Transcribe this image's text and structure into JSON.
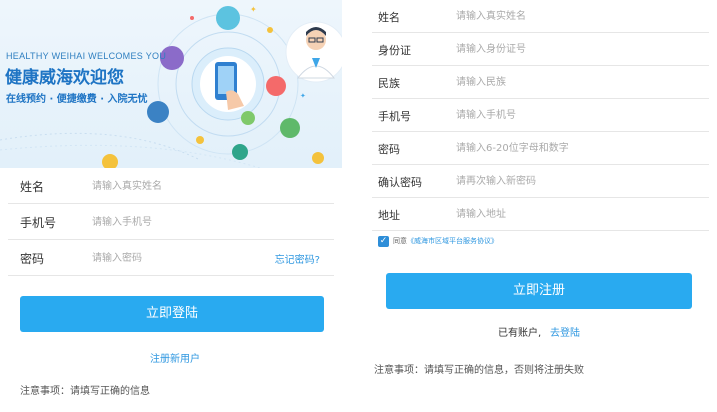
{
  "login": {
    "banner": {
      "subtitle": "HEALTHY WEIHAI WELCOMES YOU",
      "title": "健康威海欢迎您",
      "tagline": "在线预约 · 便捷缴费 · 入院无忧"
    },
    "fields": [
      {
        "label": "姓名",
        "placeholder": "请输入真实姓名"
      },
      {
        "label": "手机号",
        "placeholder": "请输入手机号"
      },
      {
        "label": "密码",
        "placeholder": "请输入密码"
      }
    ],
    "forgot_label": "忘记密码?",
    "submit_label": "立即登陆",
    "register_link": "注册新用户",
    "note": "注意事项：请填写正确的信息"
  },
  "register": {
    "fields": [
      {
        "label": "姓名",
        "placeholder": "请输入真实姓名"
      },
      {
        "label": "身份证",
        "placeholder": "请输入身份证号"
      },
      {
        "label": "民族",
        "placeholder": "请输入民族"
      },
      {
        "label": "手机号",
        "placeholder": "请输入手机号"
      },
      {
        "label": "密码",
        "placeholder": "请输入6-20位字母和数字"
      },
      {
        "label": "确认密码",
        "placeholder": "请再次输入新密码"
      },
      {
        "label": "地址",
        "placeholder": "请输入地址"
      }
    ],
    "agree_checked": true,
    "agree_prefix": "同意",
    "agree_link": "《威海市区域平台服务协议》",
    "submit_label": "立即注册",
    "have_account": "已有账户,",
    "login_link": "去登陆",
    "note": "注意事项：请填写正确的信息，否则将注册失败"
  },
  "colors": {
    "accent": "#29aaf0",
    "link": "#2e97e0",
    "banner_title": "#1e74c4"
  }
}
